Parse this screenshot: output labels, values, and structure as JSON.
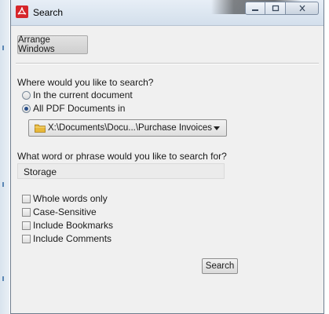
{
  "window": {
    "title": "Search"
  },
  "toolbar": {
    "arrange_label": "Arrange Windows"
  },
  "where": {
    "question": "Where would you like to search?",
    "options": [
      {
        "label": "In the current document",
        "selected": false
      },
      {
        "label": "All PDF Documents in",
        "selected": true
      }
    ],
    "location": "X:\\Documents\\Docu...\\Purchase Invoices"
  },
  "what": {
    "question": "What word or phrase would you like to search for?",
    "value": "Storage"
  },
  "options": [
    {
      "label": "Whole words only",
      "checked": false
    },
    {
      "label": "Case-Sensitive",
      "checked": false
    },
    {
      "label": "Include Bookmarks",
      "checked": false
    },
    {
      "label": "Include Comments",
      "checked": false
    }
  ],
  "actions": {
    "search_label": "Search"
  },
  "icons": {
    "app": "acrobat-icon",
    "folder": "folder-icon",
    "minimize": "minimize-icon",
    "maximize": "maximize-icon",
    "close": "close-icon"
  },
  "colors": {
    "acrobat_red": "#d6262b",
    "folder_yellow": "#e8b83a"
  }
}
